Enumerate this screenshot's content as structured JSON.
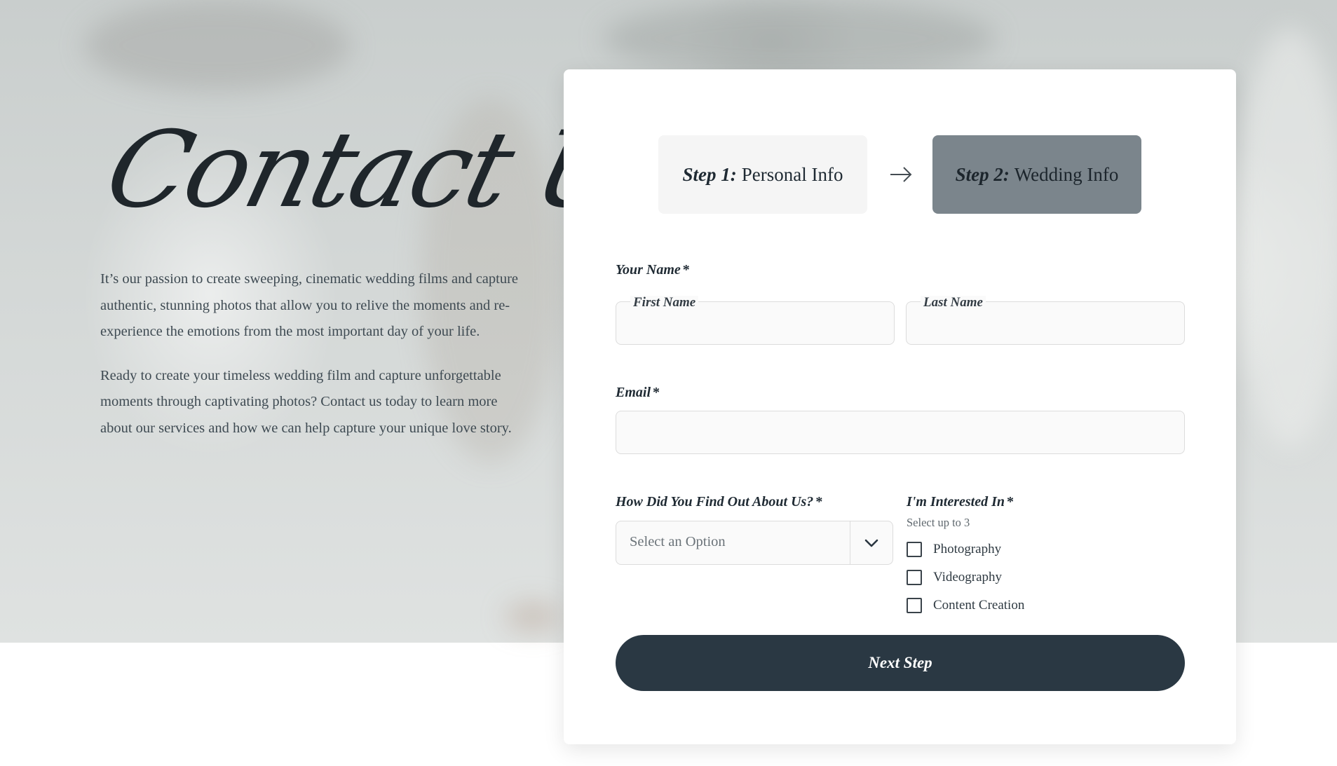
{
  "hero": {
    "title": "Contact Us",
    "paragraphs": [
      "It’s our passion to create sweeping, cinematic wedding films and capture authentic, stunning photos that allow you to relive the moments and re-experience the emotions from the most important day of your life.",
      "Ready to create your timeless wedding film and capture unforgettable moments through captivating photos? Contact us today to learn more about our services and how we can help capture your unique love story."
    ]
  },
  "steps": {
    "step1_prefix": "Step 1:",
    "step1_label": "Personal Info",
    "step2_prefix": "Step 2:",
    "step2_label": "Wedding Info",
    "arrow_icon": "arrow-right-icon"
  },
  "form": {
    "name_label": "Your Name",
    "required_mark": "*",
    "first_name_label": "First Name",
    "first_name_value": "",
    "last_name_label": "Last Name",
    "last_name_value": "",
    "email_label": "Email",
    "email_value": "",
    "source_label": "How Did You Find Out About Us?",
    "source_selected": "Select an Option",
    "interest_label": "I'm Interested In",
    "interest_hint": "Select up to 3",
    "interest_options": [
      "Photography",
      "Videography",
      "Content Creation"
    ],
    "next_button": "Next Step"
  },
  "colors": {
    "primary_button": "#2a3843",
    "active_step": "#7b858c",
    "inactive_step": "#f5f5f5"
  }
}
